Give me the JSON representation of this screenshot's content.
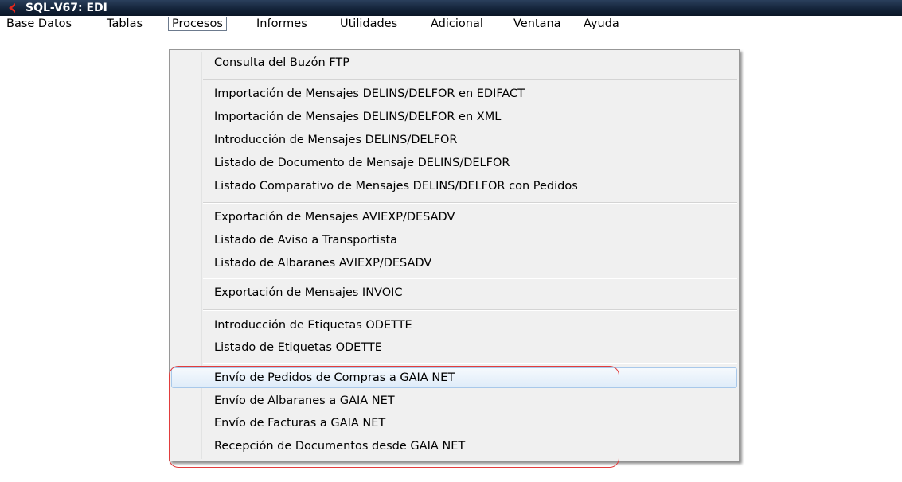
{
  "window": {
    "title": "SQL-V67: EDI",
    "app_icon": "red-chevron-icon",
    "title_bar_color": "#14243a"
  },
  "menubar": {
    "items": [
      {
        "label": "Base Datos"
      },
      {
        "label": "Tablas"
      },
      {
        "label": "Procesos",
        "active": true
      },
      {
        "label": "Informes"
      },
      {
        "label": "Utilidades"
      },
      {
        "label": "Adicional"
      },
      {
        "label": "Ventana"
      },
      {
        "label": "Ayuda"
      }
    ]
  },
  "dropdown": {
    "items": [
      {
        "label": "Consulta del Buzón FTP"
      },
      {
        "label": "Importación de Mensajes DELINS/DELFOR en EDIFACT"
      },
      {
        "label": "Importación de Mensajes DELINS/DELFOR en XML"
      },
      {
        "label": "Introducción de Mensajes DELINS/DELFOR"
      },
      {
        "label": "Listado de Documento de Mensaje DELINS/DELFOR"
      },
      {
        "label": "Listado Comparativo de Mensajes DELINS/DELFOR con Pedidos"
      },
      {
        "label": "Exportación de Mensajes AVIEXP/DESADV"
      },
      {
        "label": "Listado de Aviso a Transportista"
      },
      {
        "label": "Listado de Albaranes AVIEXP/DESADV"
      },
      {
        "label": "Exportación de Mensajes INVOIC"
      },
      {
        "label": "Introducción de Etiquetas ODETTE"
      },
      {
        "label": "Listado de Etiquetas ODETTE"
      },
      {
        "label": "Envío de Pedidos de Compras a GAIA NET",
        "highlighted": true
      },
      {
        "label": "Envío de Albaranes a GAIA NET"
      },
      {
        "label": "Envío de Facturas a GAIA NET"
      },
      {
        "label": "Recepción de Documentos desde GAIA NET"
      }
    ]
  },
  "annotation": {
    "color": "#e23c3c",
    "shape": "rounded-rectangle"
  }
}
